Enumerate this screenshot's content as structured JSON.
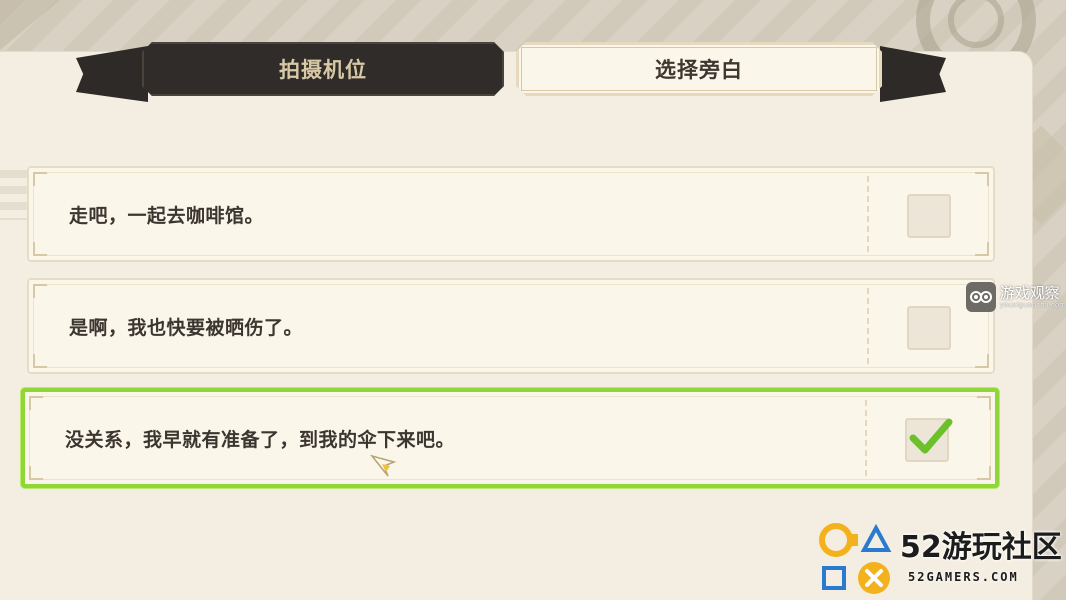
{
  "tabs": [
    {
      "label": "拍摄机位",
      "active": false
    },
    {
      "label": "选择旁白",
      "active": true
    }
  ],
  "options": [
    {
      "text": "走吧，一起去咖啡馆。",
      "checked": false
    },
    {
      "text": "是啊，我也快要被晒伤了。",
      "checked": false
    },
    {
      "text": "没关系，我早就有准备了，到我的伞下来吧。",
      "checked": true
    }
  ],
  "colors": {
    "selected_border": "#8fd636",
    "checkmark": "#6cc02a",
    "tab_dark": "#2f2c29",
    "tab_light": "#fbf6ea"
  },
  "watermark_right": {
    "title": "游戏观察",
    "subtitle": "youxiguancha.com"
  },
  "watermark_bottom": {
    "title": "52游玩社区",
    "subtitle": "52GAMERS.COM"
  },
  "icons": {
    "checkmark": "check-icon",
    "cursor": "cursor-icon",
    "watermark_right": "eye-icon",
    "watermark_bottom": "gamepad-symbols-logo"
  }
}
